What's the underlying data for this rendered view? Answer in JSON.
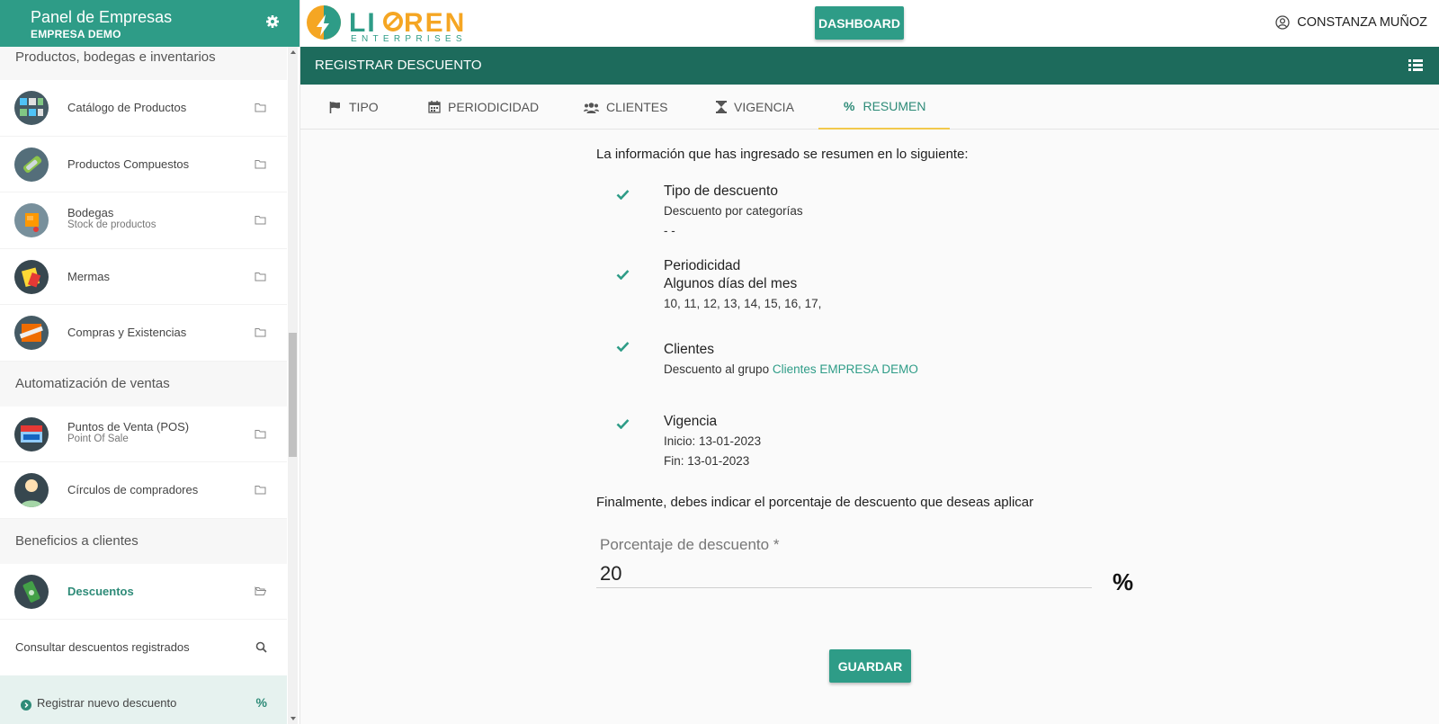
{
  "sidebar": {
    "title": "Panel de Empresas",
    "company": "EMPRESA DEMO",
    "section_products": "Productos, bodegas e inventarios",
    "items_products": [
      {
        "label": "Catálogo de Productos",
        "sub": ""
      },
      {
        "label": "Productos Compuestos",
        "sub": ""
      },
      {
        "label": "Bodegas",
        "sub": "Stock de productos"
      },
      {
        "label": "Mermas",
        "sub": ""
      },
      {
        "label": "Compras y Existencias",
        "sub": ""
      }
    ],
    "section_sales": "Automatización de ventas",
    "items_sales": [
      {
        "label": "Puntos de Venta (POS)",
        "sub": "Point Of Sale"
      },
      {
        "label": "Círculos de compradores",
        "sub": ""
      }
    ],
    "section_benefits": "Beneficios a clientes",
    "item_discounts": "Descuentos",
    "sub_consult": "Consultar descuentos registrados",
    "sub_register": "Registrar nuevo descuento"
  },
  "topbar": {
    "logo_text": "LIOREN",
    "logo_sub": "ENTERPRISES",
    "dashboard_label": "DASHBOARD",
    "user_name": "CONSTANZA MUÑOZ"
  },
  "titlebar": {
    "title": "REGISTRAR DESCUENTO"
  },
  "tabs": [
    {
      "label": "TIPO",
      "icon": "flag-icon"
    },
    {
      "label": "PERIODICIDAD",
      "icon": "calendar-icon"
    },
    {
      "label": "CLIENTES",
      "icon": "users-icon"
    },
    {
      "label": "VIGENCIA",
      "icon": "hourglass-icon"
    },
    {
      "label": "RESUMEN",
      "icon": "percent-icon",
      "active": true
    }
  ],
  "summary": {
    "intro": "La información que has ingresado se resumen en lo siguiente:",
    "tipo": {
      "heading": "Tipo de descuento",
      "line1": "Descuento por categorías",
      "line2": "- -"
    },
    "periodicidad": {
      "heading": "Periodicidad",
      "line1": "Algunos días del mes",
      "line2": "10, 11, 12, 13, 14, 15, 16, 17,"
    },
    "clientes": {
      "heading": "Clientes",
      "line1": "Descuento al grupo",
      "link": "Clientes EMPRESA DEMO"
    },
    "vigencia": {
      "heading": "Vigencia",
      "line1": "Inicio: 13-01-2023",
      "line2": "Fin: 13-01-2023"
    },
    "final": "Finalmente, debes indicar el porcentaje de descuento que deseas aplicar",
    "field_label": "Porcentaje de descuento",
    "field_required": "*",
    "field_value": "20",
    "percent_symbol": "%",
    "save_label": "GUARDAR"
  },
  "colors": {
    "primary": "#2e9c87",
    "dark": "#1d6b5c",
    "tab_indicator": "#f2c94c"
  }
}
